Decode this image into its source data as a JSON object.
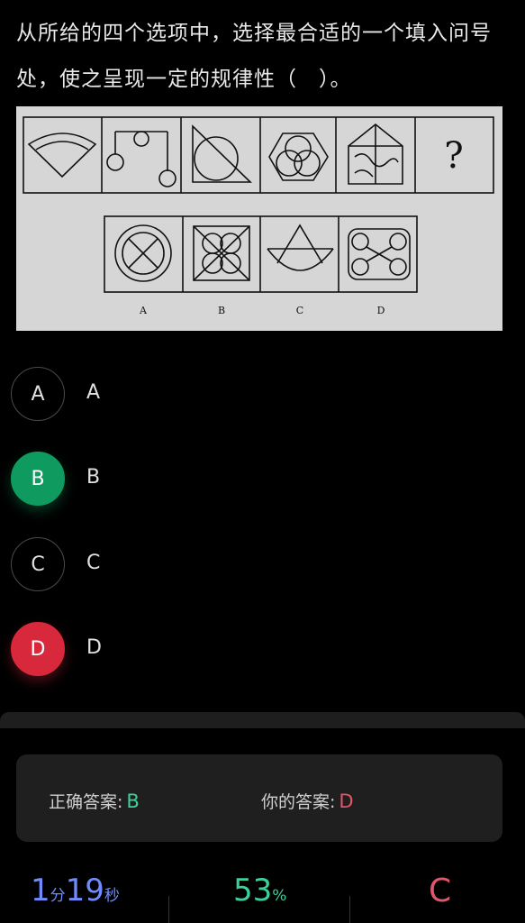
{
  "question": {
    "text": "从所给的四个选项中，选择最合适的一个填入问号处，使之呈现一定的规律性（　）。"
  },
  "puzzle": {
    "question_mark": "?",
    "option_labels": [
      "A",
      "B",
      "C",
      "D"
    ]
  },
  "options": [
    {
      "letter": "A",
      "text": "A",
      "state": "normal"
    },
    {
      "letter": "B",
      "text": "B",
      "state": "correct"
    },
    {
      "letter": "C",
      "text": "C",
      "state": "normal"
    },
    {
      "letter": "D",
      "text": "D",
      "state": "wrong"
    }
  ],
  "result": {
    "correct_label": "正确答案:",
    "correct_value": "B",
    "yours_label": "你的答案:",
    "yours_value": "D"
  },
  "stats": {
    "minutes": "1",
    "minutes_unit": "分",
    "seconds": "19",
    "seconds_unit": "秒",
    "accuracy": "53",
    "accuracy_unit": "%",
    "grade": "C"
  },
  "colors": {
    "correct": "#0f9a5f",
    "wrong": "#d8293c",
    "accent_time": "#6f8cff",
    "accent_pct": "#3cd09a"
  }
}
